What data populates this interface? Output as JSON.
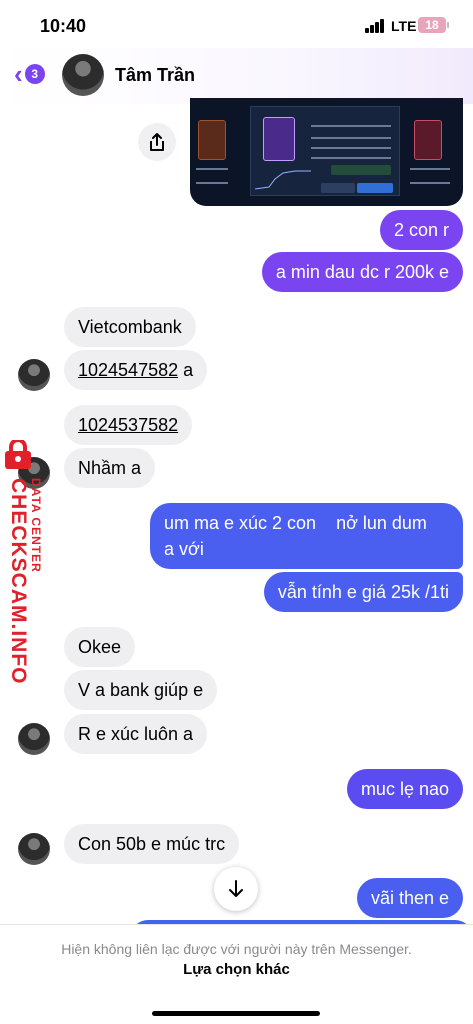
{
  "status_bar": {
    "time": "10:40",
    "network": "LTE",
    "battery": "18"
  },
  "header": {
    "back_count": "3",
    "contact_name": "Tâm Trần",
    "accent_color": "#7a44f0"
  },
  "messages": [
    {
      "side": "outgoing",
      "text": "2 con r"
    },
    {
      "side": "outgoing",
      "text": "a min dau dc  r 200k e"
    },
    {
      "side": "incoming",
      "text": "Vietcombank"
    },
    {
      "side": "incoming",
      "number": "1024547582",
      "suffix": " a"
    },
    {
      "side": "incoming",
      "number": "1024537582"
    },
    {
      "side": "incoming",
      "text": "Nhầm a"
    },
    {
      "side": "outgoing",
      "text": "um ma e xúc 2 con    nở lun dum",
      "text_line2": "a với"
    },
    {
      "side": "outgoing",
      "text": "vẫn tính e giá 25k /1ti"
    },
    {
      "side": "incoming",
      "text": "Okee"
    },
    {
      "side": "incoming",
      "text": "V a bank giúp e"
    },
    {
      "side": "incoming",
      "text": "R e xúc luôn a"
    },
    {
      "side": "outgoing",
      "text": "muc lẹ nao"
    },
    {
      "side": "incoming",
      "text": "Con 50b e múc trc"
    },
    {
      "side": "outgoing",
      "text": "vãi then e"
    }
  ],
  "watermark": {
    "brand": "CHECKSCAM.INFO",
    "sub": "DATA CENTER",
    "color": "#e0202a"
  },
  "footer": {
    "notice": "Hiện không liên lạc được với người này trên Messenger.",
    "option": "Lựa chọn khác"
  },
  "icons": [
    "back-chevron-icon",
    "share-icon",
    "arrow-down-icon",
    "lock-icon"
  ]
}
